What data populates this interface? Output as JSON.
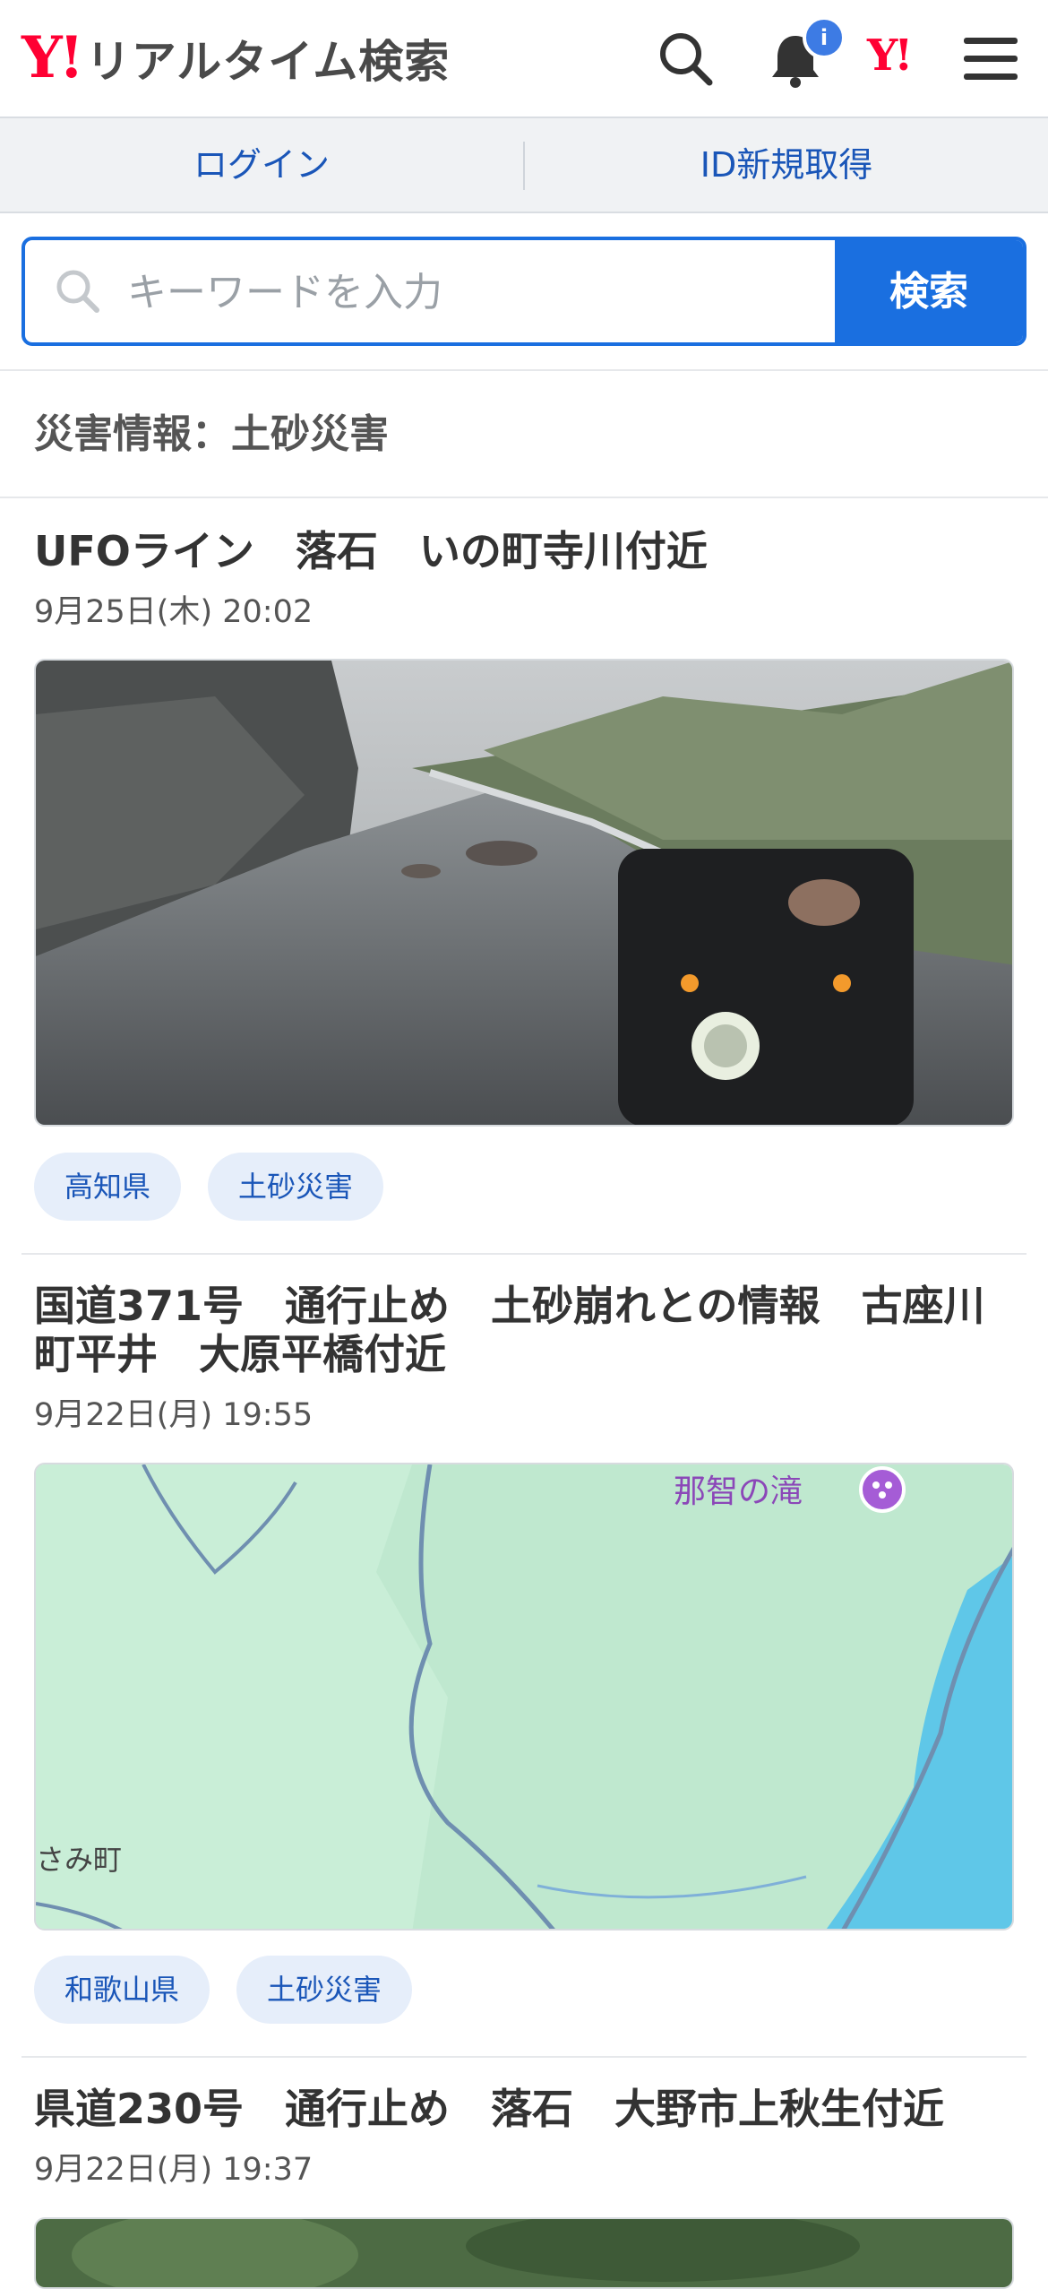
{
  "header": {
    "logo_mark": "Y!",
    "logo_text": "リアルタイム検索",
    "notification_badge": "i",
    "yahoo_mark": "Y!",
    "icons": [
      "search-icon",
      "bell-icon",
      "yahoo-logo-icon",
      "menu-icon"
    ]
  },
  "account": {
    "login_label": "ログイン",
    "register_label": "ID新規取得"
  },
  "search": {
    "placeholder": "キーワードを入力",
    "button_label": "検索"
  },
  "section": {
    "title": "災害情報：土砂災害"
  },
  "articles": [
    {
      "title": "UFOライン　落石　いの町寺川付近",
      "timestamp": "9月25日(木) 20:02",
      "tags": [
        "高知県",
        "土砂災害"
      ]
    },
    {
      "title": "国道371号　通行止め　土砂崩れとの情報　古座川町平井　大原平橋付近",
      "timestamp": "9月22日(月) 19:55",
      "map_labels": {
        "poi": "那智の滝",
        "town": "さみ町"
      },
      "tags": [
        "和歌山県",
        "土砂災害"
      ]
    },
    {
      "title": "県道230号　通行止め　落石　大野市上秋生付近",
      "timestamp": "9月22日(月) 19:37"
    }
  ],
  "colors": {
    "accent": "#1a6fe0",
    "brand": "#ff0033",
    "tag_bg": "#e6eefa",
    "tag_text": "#1a56b8"
  }
}
